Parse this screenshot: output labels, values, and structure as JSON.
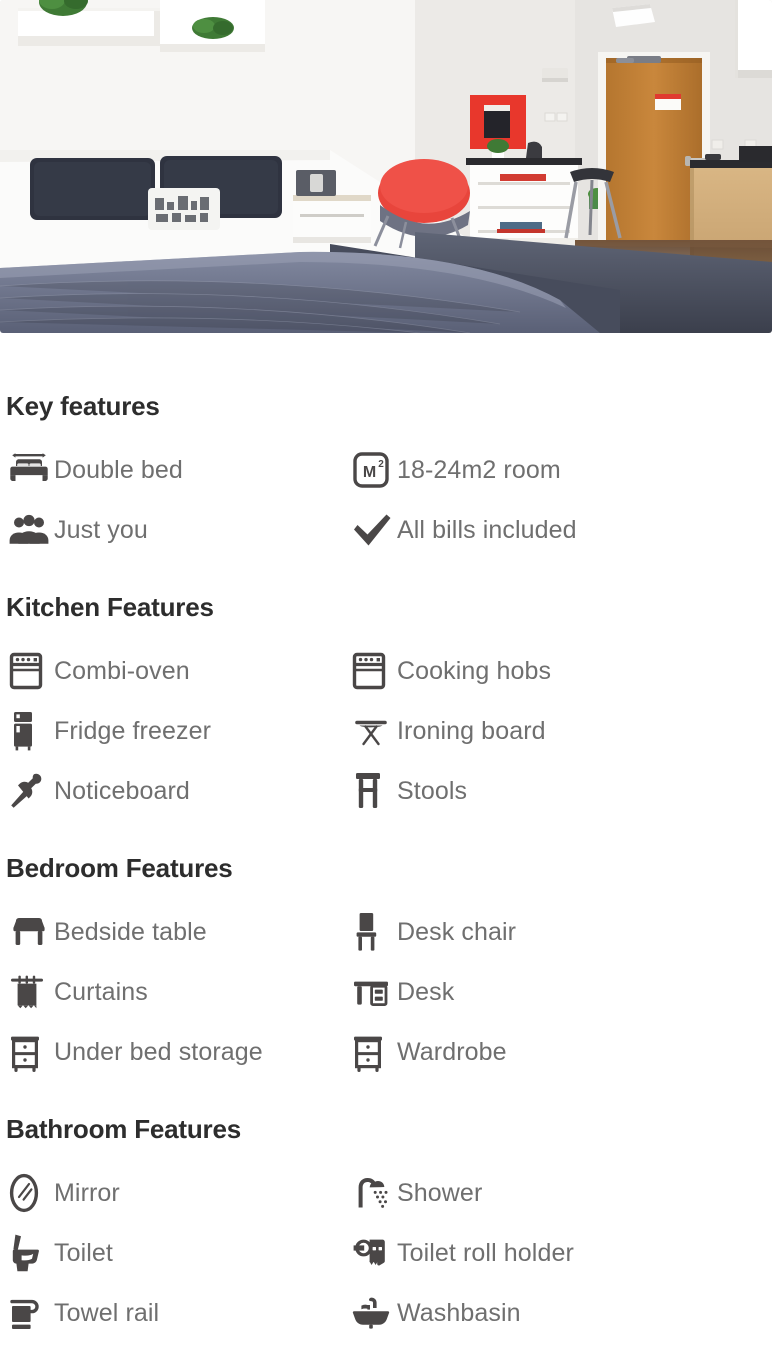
{
  "hero": {
    "name": "studio-room-photo",
    "alt": "Studio apartment interior with double bed, red chair, breakfast bar and kitchen"
  },
  "sections": [
    {
      "id": "key-features",
      "title": "Key features",
      "features": [
        {
          "icon": "double-bed-icon",
          "label": "Double bed"
        },
        {
          "icon": "square-metre-icon",
          "label": "18-24m2 room"
        },
        {
          "icon": "people-group-icon",
          "label": "Just you"
        },
        {
          "icon": "check-mark-icon",
          "label": "All bills included"
        }
      ]
    },
    {
      "id": "kitchen-features",
      "title": "Kitchen Features",
      "features": [
        {
          "icon": "oven-icon",
          "label": "Combi-oven"
        },
        {
          "icon": "cooking-hobs-icon",
          "label": "Cooking hobs"
        },
        {
          "icon": "fridge-freezer-icon",
          "label": "Fridge freezer"
        },
        {
          "icon": "ironing-board-icon",
          "label": "Ironing board"
        },
        {
          "icon": "pushpin-icon",
          "label": "Noticeboard"
        },
        {
          "icon": "stool-icon",
          "label": "Stools"
        }
      ]
    },
    {
      "id": "bedroom-features",
      "title": "Bedroom Features",
      "features": [
        {
          "icon": "bedside-table-icon",
          "label": "Bedside table"
        },
        {
          "icon": "desk-chair-icon",
          "label": "Desk chair"
        },
        {
          "icon": "curtains-icon",
          "label": "Curtains"
        },
        {
          "icon": "desk-icon",
          "label": "Desk"
        },
        {
          "icon": "under-bed-storage-icon",
          "label": "Under bed storage"
        },
        {
          "icon": "wardrobe-icon",
          "label": "Wardrobe"
        }
      ]
    },
    {
      "id": "bathroom-features",
      "title": "Bathroom Features",
      "features": [
        {
          "icon": "mirror-icon",
          "label": "Mirror"
        },
        {
          "icon": "shower-icon",
          "label": "Shower"
        },
        {
          "icon": "toilet-icon",
          "label": "Toilet"
        },
        {
          "icon": "toilet-roll-holder-icon",
          "label": "Toilet roll holder"
        },
        {
          "icon": "towel-rail-icon",
          "label": "Towel rail"
        },
        {
          "icon": "washbasin-icon",
          "label": "Washbasin"
        }
      ]
    }
  ],
  "colors": {
    "heading": "#2d2d2d",
    "label": "#6f6f6f",
    "icon": "#4a4747",
    "background": "#ffffff"
  }
}
